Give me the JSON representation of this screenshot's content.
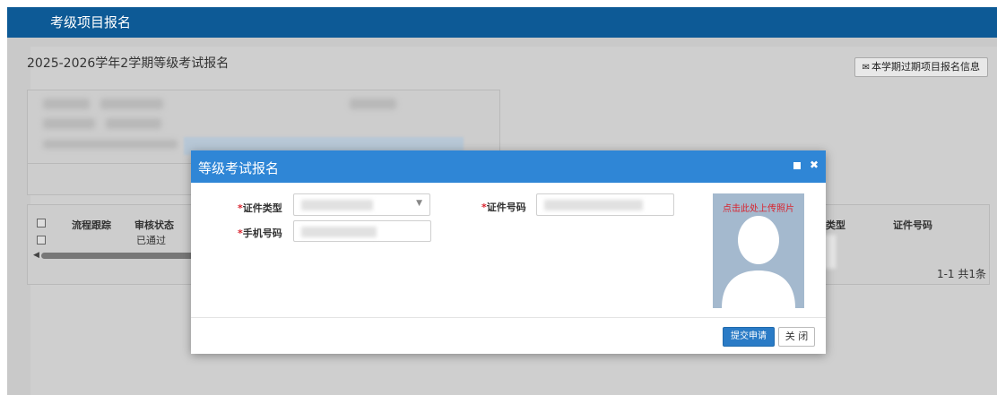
{
  "topbar": {
    "title": "考级项目报名"
  },
  "page": {
    "term_title": "2025-2026学年2学期等级考试报名",
    "expired_button": "本学期过期项目报名信息"
  },
  "table": {
    "headers": [
      "流程跟踪",
      "审核状态",
      "类型",
      "证件号码"
    ],
    "rows": [
      {
        "status": "已通过"
      }
    ],
    "pager": "1-1  共1条"
  },
  "modal": {
    "title": "等级考试报名",
    "fields": {
      "id_type": {
        "required_mark": "*",
        "label": "证件类型"
      },
      "id_number": {
        "required_mark": "*",
        "label": "证件号码"
      },
      "phone": {
        "required_mark": "*",
        "label": "手机号码"
      }
    },
    "photo_hint": "点击此处上传照片",
    "submit": "提交申请",
    "close": "关 闭"
  },
  "colors": {
    "topbar": "#0d5a96",
    "modal_header": "#2f86d6",
    "submit_button": "#2a7bc6",
    "required": "#d9232e"
  }
}
